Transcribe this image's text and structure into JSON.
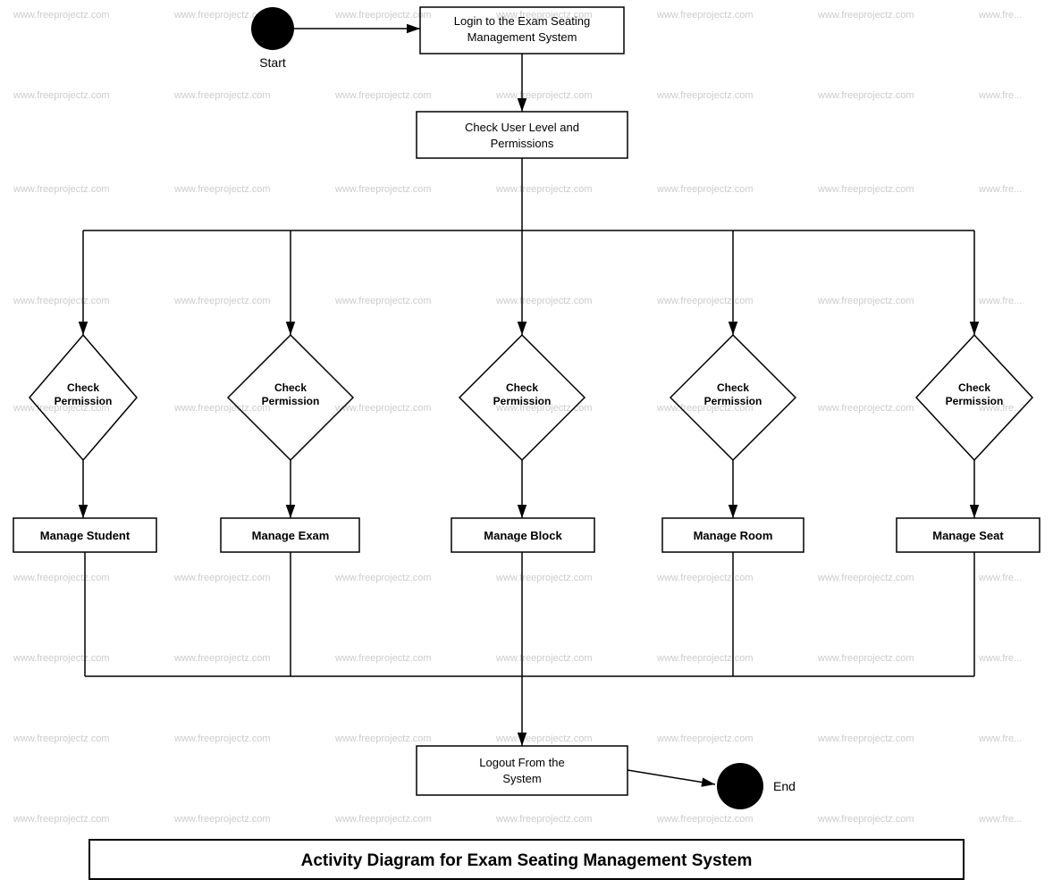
{
  "diagram": {
    "title": "Activity Diagram for Exam Seating Management System",
    "watermark": "www.freeprojectz.com",
    "nodes": {
      "start_label": "Start",
      "end_label": "End",
      "login": "Login to the Exam Seating Management System",
      "check_user_level": "Check User Level and Permissions",
      "check_permission_1": "Check Permission",
      "check_permission_2": "Check Permission",
      "check_permission_3": "Check Permission",
      "check_permission_4": "Check Permission",
      "check_permission_5": "Check Permission",
      "manage_student": "Manage Student",
      "manage_exam": "Manage Exam",
      "manage_block": "Manage Block",
      "manage_room": "Manage Room",
      "manage_seat": "Manage Seat",
      "logout": "Logout From the System"
    }
  }
}
